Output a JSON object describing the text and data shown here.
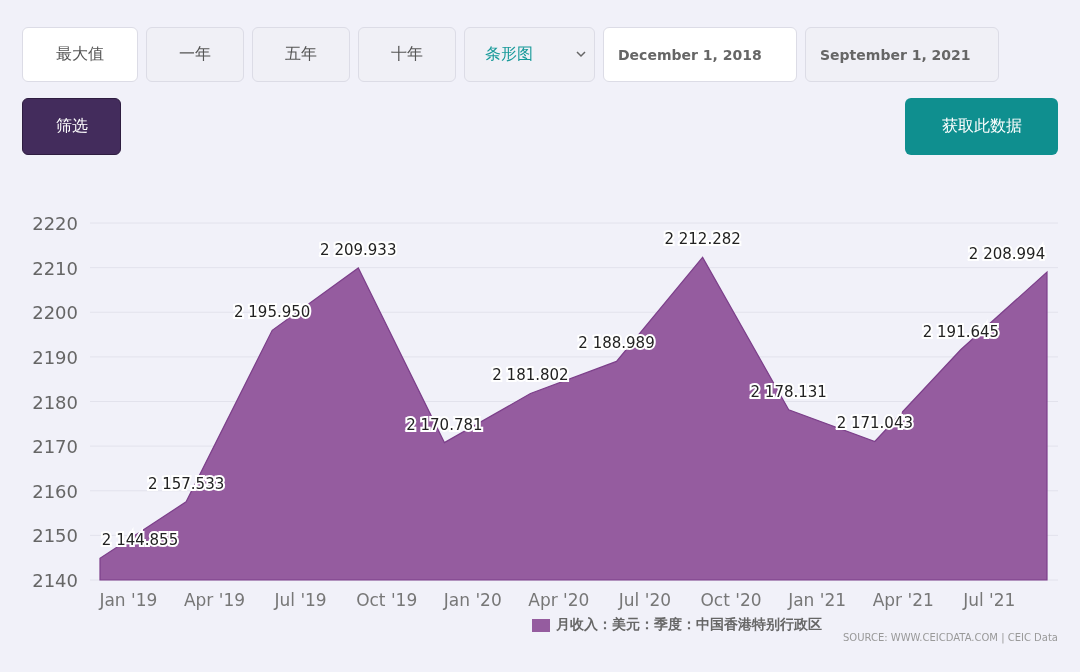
{
  "range_buttons": [
    {
      "label": "最大值",
      "selected": true
    },
    {
      "label": "一年",
      "selected": false
    },
    {
      "label": "五年",
      "selected": false
    },
    {
      "label": "十年",
      "selected": false
    }
  ],
  "chart_type_select": {
    "value": "条形图"
  },
  "date_fields": [
    {
      "value": "December 1, 2018",
      "disabled": false
    },
    {
      "value": "September 1, 2021",
      "disabled": true
    }
  ],
  "filter_button": {
    "label": "筛选"
  },
  "get_data_button": {
    "label": "获取此数据"
  },
  "chart": {
    "chart_data": {
      "type": "area",
      "categories": [
        null,
        null,
        null,
        null,
        null,
        null,
        null,
        null,
        null,
        null,
        null,
        null
      ],
      "grid": true,
      "ylim": [
        2140,
        2220
      ],
      "yticks": [
        2140,
        2150,
        2160,
        2170,
        2180,
        2190,
        2200,
        2210,
        2220
      ],
      "series": [
        {
          "name": "月收入：美元：季度：中国香港特别行政区",
          "color": "#955c9f",
          "values": [
            2144.855,
            2157.533,
            2195.95,
            2209.933,
            2170.781,
            2181.802,
            2188.989,
            2212.282,
            2178.131,
            2171.043,
            2191.645,
            2208.994
          ]
        }
      ],
      "value_labels": [
        "2 144.855",
        "2 157.533",
        "2 195.950",
        "2 209.933",
        "2 170.781",
        "2 181.802",
        "2 188.989",
        "2 212.282",
        "2 178.131",
        "2 171.043",
        "2 191.645",
        "2 208.994"
      ]
    },
    "x_axis_labels": [
      "Jan '19",
      "Apr '19",
      "Jul '19",
      "Oct '19",
      "Jan '20",
      "Apr '20",
      "Jul '20",
      "Oct '20",
      "Jan '21",
      "Apr '21",
      "Jul '21"
    ],
    "source": "SOURCE: WWW.CEICDATA.COM | CEIC Data"
  }
}
